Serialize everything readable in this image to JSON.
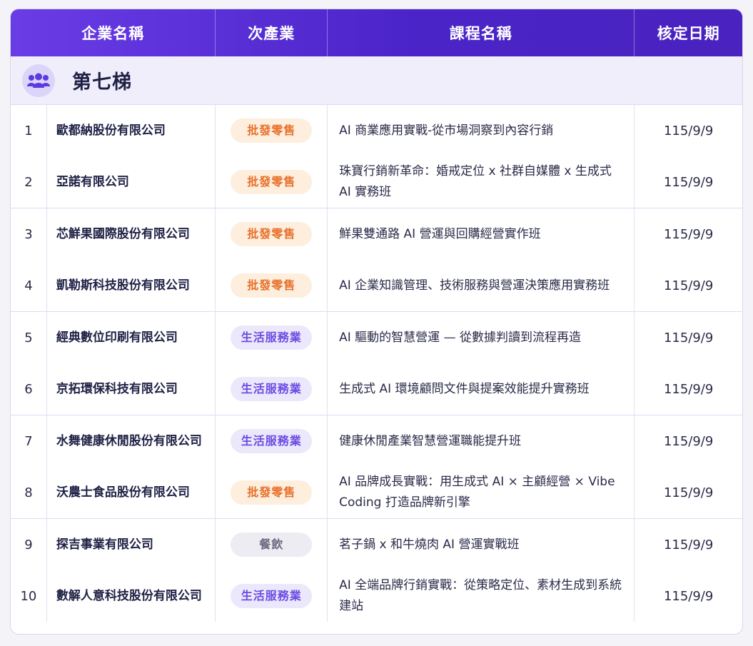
{
  "header": {
    "company": "企業名稱",
    "sector": "次產業",
    "course": "課程名稱",
    "date": "核定日期"
  },
  "group": {
    "title": "第七梯",
    "icon": "users-group-icon"
  },
  "colors": {
    "header_start": "#6a3ce6",
    "header_end": "#4a22bf",
    "wholesale_badge": "#e8702a",
    "lifestyle_badge": "#6b4be2",
    "dining_badge": "#6a6b80"
  },
  "rows": [
    {
      "num": "1",
      "company": "歐都納股份有限公司",
      "sector": "批發零售",
      "sector_type": "wholesale",
      "course": "AI 商業應用實戰-從市場洞察到內容行銷",
      "date": "115/9/9"
    },
    {
      "num": "2",
      "company": "亞諾有限公司",
      "sector": "批發零售",
      "sector_type": "wholesale",
      "course": "珠寶行銷新革命：婚戒定位 x 社群自媒體 x 生成式 AI 實務班",
      "date": "115/9/9"
    },
    {
      "num": "3",
      "company": "芯鮮果國際股份有限公司",
      "sector": "批發零售",
      "sector_type": "wholesale",
      "course": "鮮果雙通路 AI 營運與回購經營實作班",
      "date": "115/9/9"
    },
    {
      "num": "4",
      "company": "凱勒斯科技股份有限公司",
      "sector": "批發零售",
      "sector_type": "wholesale",
      "course": "AI 企業知識管理、技術服務與營運決策應用實務班",
      "date": "115/9/9"
    },
    {
      "num": "5",
      "company": "經典數位印刷有限公司",
      "sector": "生活服務業",
      "sector_type": "lifestyle",
      "course": "AI 驅動的智慧營運 — 從數據判讀到流程再造",
      "date": "115/9/9"
    },
    {
      "num": "6",
      "company": "京拓環保科技有限公司",
      "sector": "生活服務業",
      "sector_type": "lifestyle",
      "course": "生成式 AI 環境顧問文件與提案效能提升實務班",
      "date": "115/9/9"
    },
    {
      "num": "7",
      "company": "水舞健康休閒股份有限公司",
      "sector": "生活服務業",
      "sector_type": "lifestyle",
      "course": "健康休閒產業智慧營運職能提升班",
      "date": "115/9/9"
    },
    {
      "num": "8",
      "company": "沃農士食品股份有限公司",
      "sector": "批發零售",
      "sector_type": "wholesale",
      "course": "AI 品牌成長實戰：用生成式 AI × 主顧經營 × Vibe Coding 打造品牌新引擎",
      "date": "115/9/9"
    },
    {
      "num": "9",
      "company": "探吉事業有限公司",
      "sector": "餐飲",
      "sector_type": "dining",
      "course": "茗子鍋 x 和牛燒肉 AI 營運實戰班",
      "date": "115/9/9"
    },
    {
      "num": "10",
      "company": "數解人意科技股份有限公司",
      "sector": "生活服務業",
      "sector_type": "lifestyle",
      "course": "AI 全端品牌行銷實戰：從策略定位、素材生成到系統建站",
      "date": "115/9/9"
    }
  ]
}
